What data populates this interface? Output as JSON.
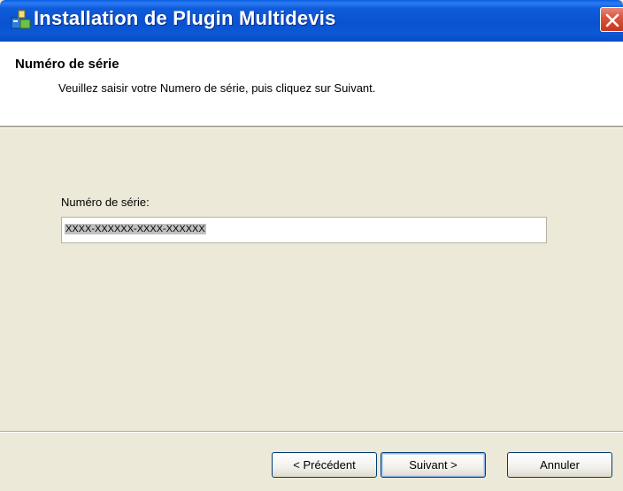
{
  "window": {
    "title": "Installation de Plugin Multidevis",
    "icon": "installer-icon",
    "close_icon": "close-icon"
  },
  "header": {
    "title": "Numéro de série",
    "description": "Veuillez saisir votre Numero de série, puis cliquez sur Suivant."
  },
  "form": {
    "serial_label": "Numéro de série:",
    "serial_value": "XXXX-XXXXXX-XXXX-XXXXXX"
  },
  "buttons": {
    "previous": "< Précédent",
    "next": "Suivant >",
    "cancel": "Annuler"
  },
  "colors": {
    "titlebar": "#0A52D0",
    "close_button": "#D9573E",
    "dialog_bg": "#ECE9D8",
    "button_border": "#003C74"
  }
}
